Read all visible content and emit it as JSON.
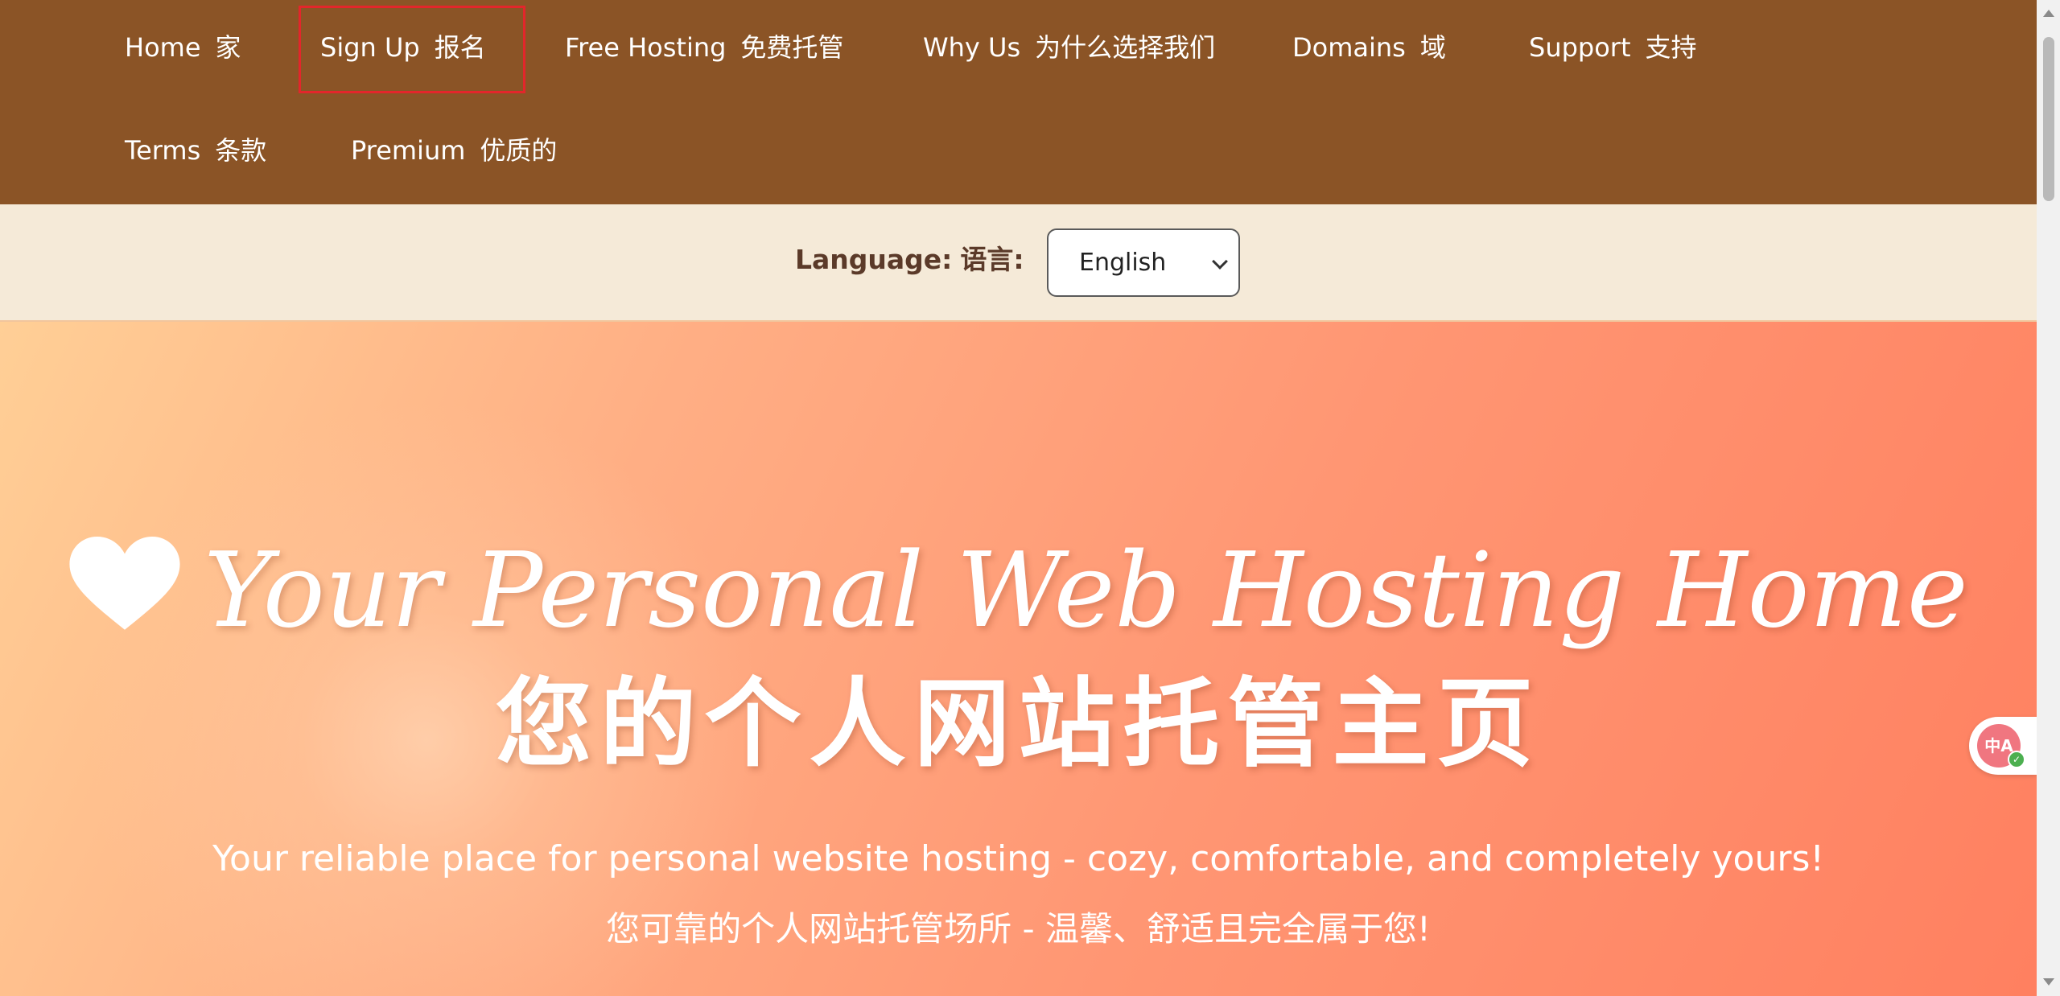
{
  "nav": {
    "items": [
      {
        "en": "Home",
        "zh": "家"
      },
      {
        "en": "Sign Up",
        "zh": "报名"
      },
      {
        "en": "Free Hosting",
        "zh": "免费托管"
      },
      {
        "en": "Why Us",
        "zh": "为什么选择我们"
      },
      {
        "en": "Domains",
        "zh": "域"
      },
      {
        "en": "Support",
        "zh": "支持"
      },
      {
        "en": "Terms",
        "zh": "条款"
      },
      {
        "en": "Premium",
        "zh": "优质的"
      }
    ]
  },
  "language": {
    "label_en": "Language:",
    "label_zh": "语言:",
    "selected": "English"
  },
  "hero": {
    "title": "Your Personal Web Hosting Home",
    "title_zh": "您的个人网站托管主页",
    "subtitle": "Your reliable place for personal website hosting - cozy, comfortable, and completely yours!",
    "subtitle_zh": "您可靠的个人网站托管场所 - 温馨、舒适且完全属于您!"
  },
  "widget": {
    "icon_text": "中A"
  },
  "colors": {
    "nav_bg": "#8b5426",
    "lang_bar_bg": "#f5ead8",
    "hero_start": "#ffcf96",
    "hero_end": "#ff8060",
    "highlight_outline": "#e3262b"
  }
}
